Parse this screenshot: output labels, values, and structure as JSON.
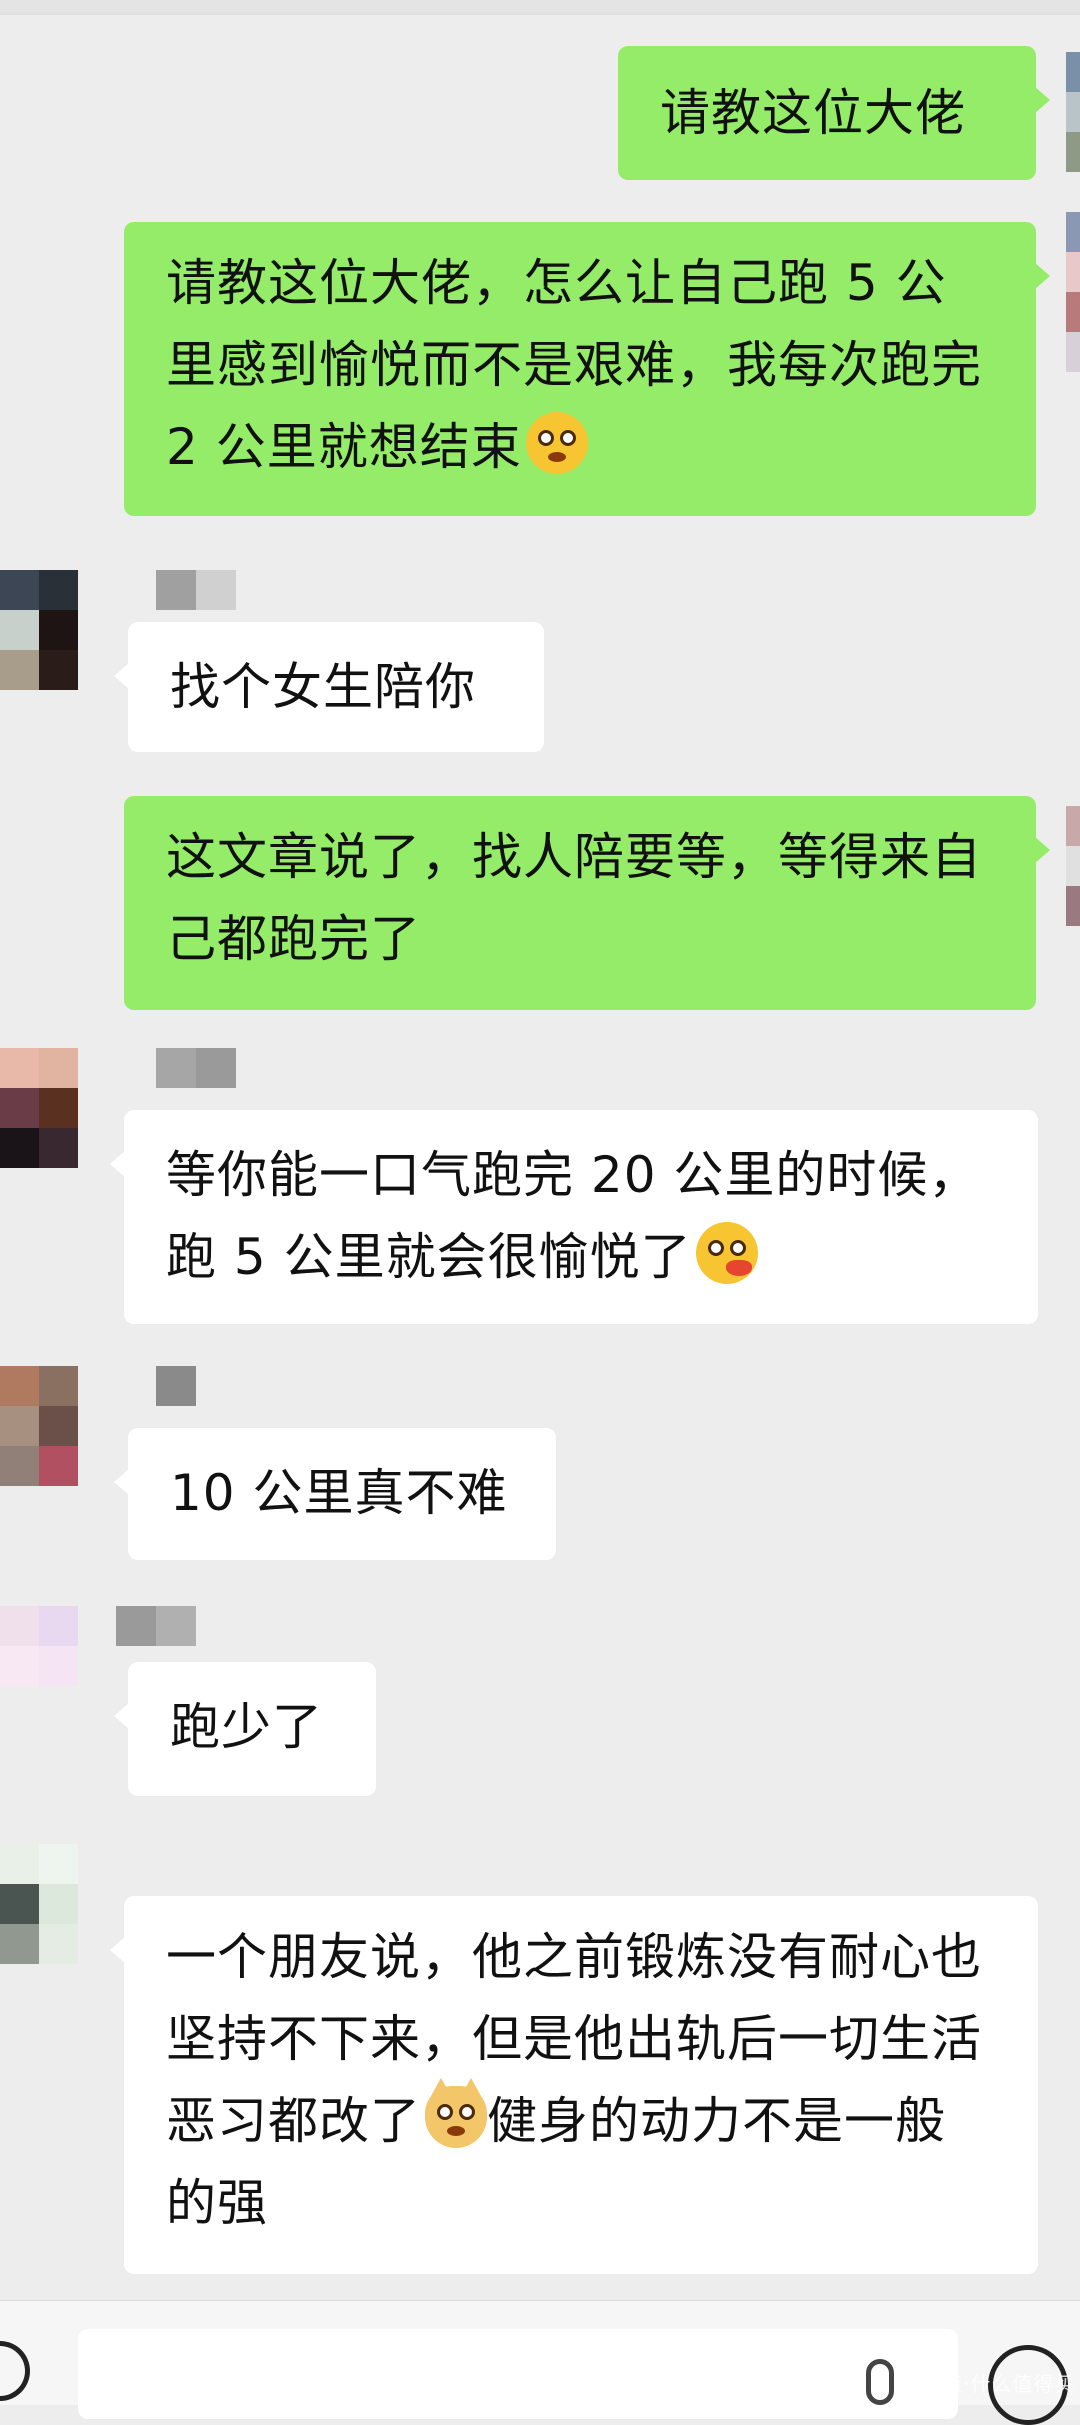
{
  "app": {
    "name": "chat"
  },
  "messages": [
    {
      "side": "out",
      "text": "请教这位大佬"
    },
    {
      "side": "out",
      "text": "请教这位大佬，怎么让自己跑 5 公里感到愉悦而不是艰难，我每次跑完 2 公里就想结束",
      "emoji": "flushed-face"
    },
    {
      "side": "in",
      "text": "找个女生陪你"
    },
    {
      "side": "out",
      "text": "这文章说了，找人陪要等，等得来自己都跑完了"
    },
    {
      "side": "in",
      "text": "等你能一口气跑完 20 公里的时候，跑 5 公里就会很愉悦了",
      "emoji": "eating-face"
    },
    {
      "side": "in",
      "text": "10 公里真不难"
    },
    {
      "side": "in",
      "text": "跑少了"
    },
    {
      "side": "in",
      "text_before": "一个朋友说，他之前锻炼没有耐心也坚持不下来，但是他出轨后一切生活恶习都改了",
      "emoji": "smirking-cat",
      "text_after": "健身的动力不是一般的强"
    }
  ],
  "colors": {
    "background": "#ededed",
    "outgoing_bubble": "#95ec69",
    "incoming_bubble": "#ffffff"
  },
  "input_bar": {
    "left_icon": "voice-icon",
    "mic_icon": "mic-icon",
    "right_icon": "emoji-icon"
  },
  "watermark": "值·什么值得买"
}
